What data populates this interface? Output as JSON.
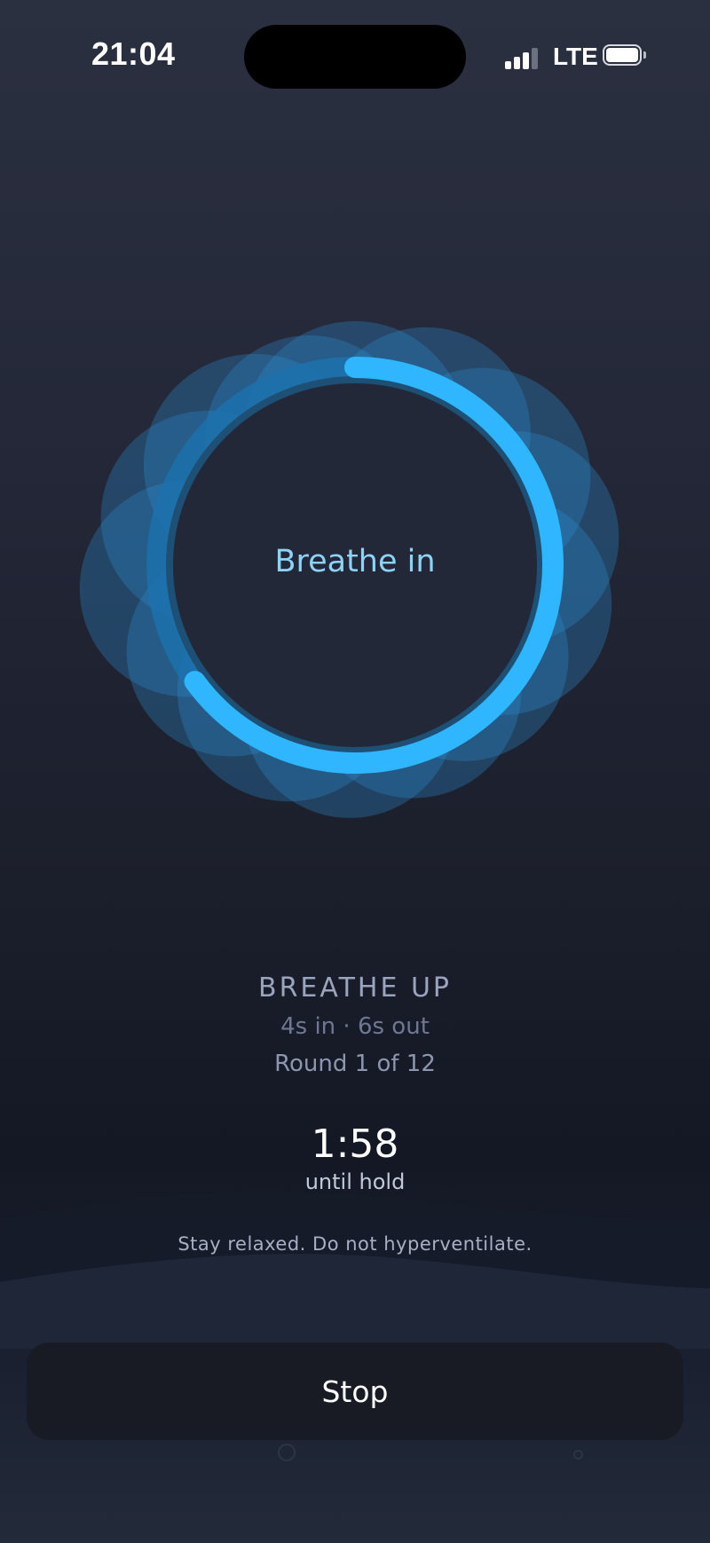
{
  "status_bar": {
    "time": "21:04",
    "network": "LTE",
    "signal_icon": "cellular-signal-icon",
    "battery_icon": "battery-icon"
  },
  "session": {
    "phase": "Breathe in",
    "exercise_name": "BREATHE UP",
    "timing": "4s in · 6s out",
    "round": "Round 1 of 12",
    "countdown": "1:58",
    "countdown_caption": "until hold",
    "hint": "Stay relaxed. Do not hyperventilate.",
    "phase_progress": 0.65
  },
  "actions": {
    "stop_label": "Stop"
  },
  "colors": {
    "accent": "#2fb6ff",
    "accent_dark": "#1d7fc0",
    "blob": "#2a8cd0",
    "phase_text": "#8fd2f8"
  }
}
